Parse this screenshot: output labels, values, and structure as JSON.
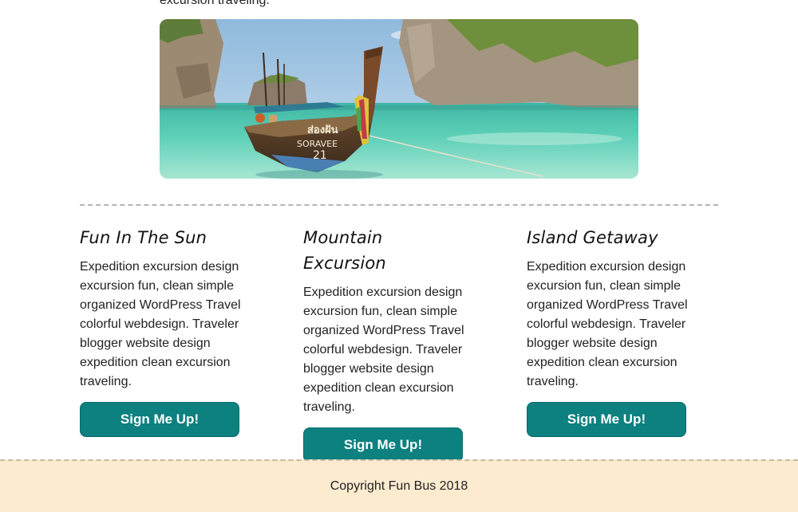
{
  "intro": {
    "tail_text": "excursion traveling."
  },
  "hero": {
    "image_name": "longtail-boat-tropical-beach-image",
    "boat_label_line1": "ส่องฝัน",
    "boat_label_line2": "SORAVEE",
    "boat_label_line3": "21"
  },
  "columns": [
    {
      "title": "Fun In The Sun",
      "body": "Expedition excursion design excursion fun, clean simple organized WordPress Travel colorful webdesign. Traveler blogger website design expedition clean excursion traveling.",
      "button_label": "Sign Me Up!"
    },
    {
      "title": "Mountain Excursion",
      "body": "Expedition excursion design excursion fun, clean simple organized WordPress Travel colorful webdesign. Traveler blogger website design expedition clean excursion traveling.",
      "button_label": "Sign Me Up!"
    },
    {
      "title": "Island Getaway",
      "body": "Expedition excursion design excursion fun, clean simple organized WordPress Travel colorful webdesign. Traveler blogger website design expedition clean excursion traveling.",
      "button_label": "Sign Me Up!"
    }
  ],
  "footer": {
    "copyright": "Copyright Fun Bus 2018"
  },
  "colors": {
    "button_bg": "#0d8080",
    "footer_bg": "#fdebd0",
    "divider": "#b5b5b5"
  }
}
